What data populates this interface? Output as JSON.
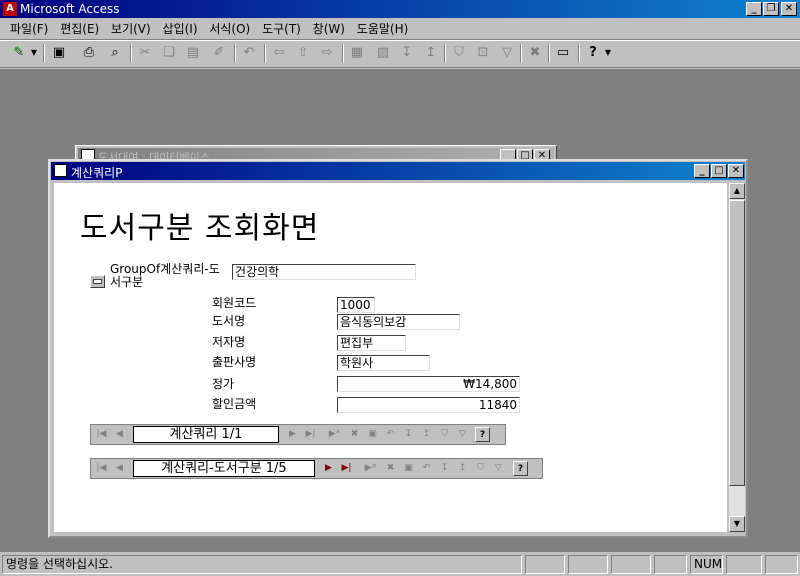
{
  "app": {
    "title": "Microsoft Access"
  },
  "menu": [
    "파일(F)",
    "편집(E)",
    "보기(V)",
    "삽입(I)",
    "서식(O)",
    "도구(T)",
    "창(W)",
    "도움말(H)"
  ],
  "background_window": {
    "title": "도서대여 : 데이터베이스"
  },
  "form_window": {
    "title": "계산쿼리P"
  },
  "form": {
    "heading": "도서구분 조회화면",
    "group_label": "GroupOf계산쿼리-도서구분",
    "group_value": "건강의학",
    "fields": [
      {
        "label": "회원코드",
        "value": "1000"
      },
      {
        "label": "도서명",
        "value": "음식동의보감"
      },
      {
        "label": "저자명",
        "value": "편집부"
      },
      {
        "label": "출판사명",
        "value": "학원사"
      },
      {
        "label": "정가",
        "value": "₩14,800"
      },
      {
        "label": "할인금액",
        "value": "11840"
      }
    ]
  },
  "nav_inner": {
    "text": "계산쿼리 1/1"
  },
  "nav_outer": {
    "text": "계산쿼리-도서구분 1/5"
  },
  "statusbar": {
    "message": "명령을 선택하십시오.",
    "num": "NUM"
  }
}
